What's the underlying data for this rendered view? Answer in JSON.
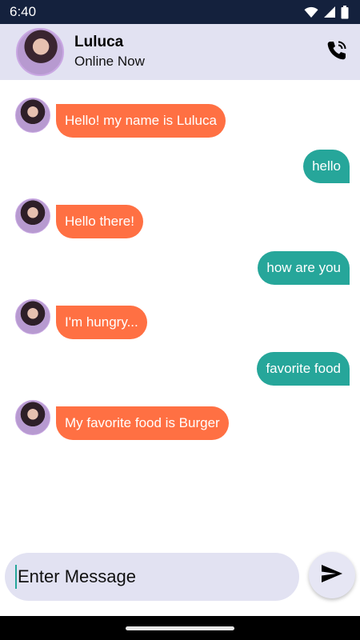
{
  "status_bar": {
    "time": "6:40",
    "icons": [
      "wifi-icon",
      "signal-icon",
      "battery-icon"
    ]
  },
  "header": {
    "contact_name": "Luluca",
    "contact_status": "Online Now",
    "call_icon": "phone-call-icon"
  },
  "messages": [
    {
      "direction": "incoming",
      "text": "Hello! my name is Luluca"
    },
    {
      "direction": "outgoing",
      "text": "hello"
    },
    {
      "direction": "incoming",
      "text": "Hello there!"
    },
    {
      "direction": "outgoing",
      "text": "how are you"
    },
    {
      "direction": "incoming",
      "text": "I'm hungry..."
    },
    {
      "direction": "outgoing",
      "text": "favorite food"
    },
    {
      "direction": "incoming",
      "text": "My favorite food is Burger"
    }
  ],
  "composer": {
    "placeholder": "Enter Message",
    "send_icon": "send-icon"
  },
  "colors": {
    "status_bar": "#14213d",
    "header": "#e2e2f2",
    "incoming_bubble": "#ff7043",
    "outgoing_bubble": "#26a69a"
  }
}
